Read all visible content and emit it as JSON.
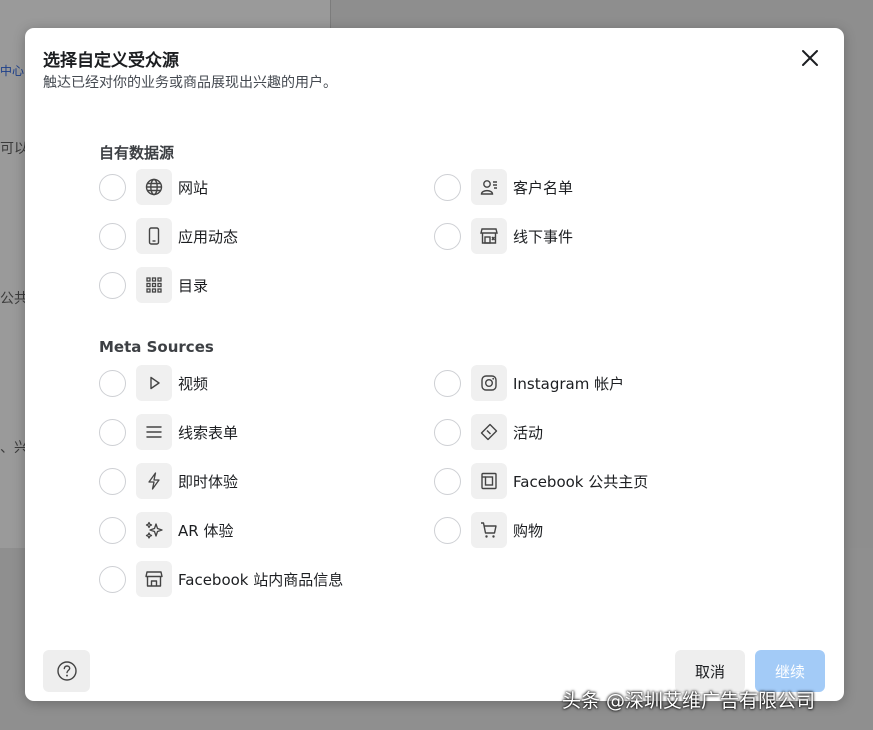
{
  "background": {
    "texts": [
      "中心(",
      "可以",
      "公共",
      "、兴"
    ]
  },
  "dialog": {
    "title": "选择自定义受众源",
    "subtitle": "触达已经对你的业务或商品展现出兴趣的用户。"
  },
  "sections": {
    "own": {
      "title": "自有数据源",
      "items": [
        {
          "label": "网站",
          "icon": "globe-icon"
        },
        {
          "label": "客户名单",
          "icon": "customer-list-icon"
        },
        {
          "label": "应用动态",
          "icon": "mobile-icon"
        },
        {
          "label": "线下事件",
          "icon": "store-icon"
        },
        {
          "label": "目录",
          "icon": "grid-icon"
        }
      ]
    },
    "meta": {
      "title": "Meta Sources",
      "items": [
        {
          "label": "视频",
          "icon": "play-icon"
        },
        {
          "label": "Instagram 帐户",
          "icon": "instagram-icon"
        },
        {
          "label": "线索表单",
          "icon": "list-icon"
        },
        {
          "label": "活动",
          "icon": "ticket-icon"
        },
        {
          "label": "即时体验",
          "icon": "lightning-icon"
        },
        {
          "label": "Facebook 公共主页",
          "icon": "page-icon"
        },
        {
          "label": "AR 体验",
          "icon": "sparkle-icon"
        },
        {
          "label": "购物",
          "icon": "cart-icon"
        },
        {
          "label": "Facebook 站内商品信息",
          "icon": "shop-icon"
        }
      ]
    }
  },
  "footer": {
    "cancel_label": "取消",
    "continue_label": "继续",
    "help_icon": "help-icon"
  },
  "watermark": "头条 @深圳艾维广告有限公司"
}
